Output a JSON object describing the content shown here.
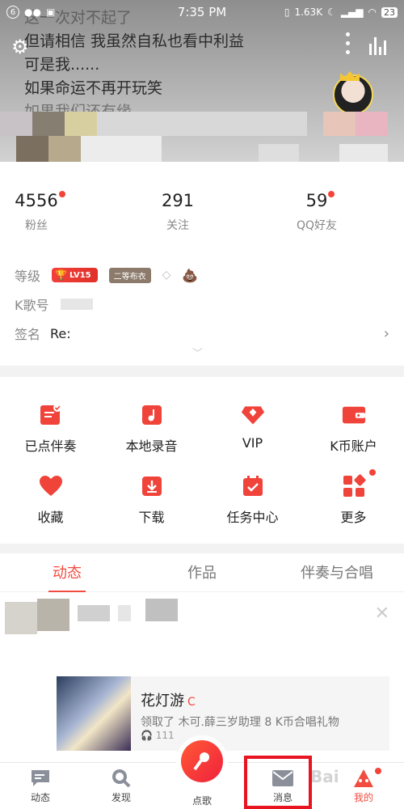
{
  "status_bar": {
    "notif_count": "6",
    "time": "7:35 PM",
    "speed": "1.63K",
    "battery": "23"
  },
  "lyrics": [
    "这一次对不起了",
    "但请相信 我虽然自私也看中利益",
    "可是我......",
    "如果命运不再开玩笑",
    "如果我们还有缘"
  ],
  "stats": [
    {
      "value": "4556",
      "label": "粉丝",
      "has_dot": true
    },
    {
      "value": "291",
      "label": "关注",
      "has_dot": false
    },
    {
      "value": "59",
      "label": "QQ好友",
      "has_dot": true
    }
  ],
  "profile": {
    "level_label": "等级",
    "level_badge": "LV15",
    "cloth_badge": "二等布衣",
    "kid_label": "K歌号",
    "signature_label": "签名",
    "signature_value": "Re:"
  },
  "menu": [
    {
      "label": "已点伴奏",
      "icon": "accompaniment-icon",
      "dot": false
    },
    {
      "label": "本地录音",
      "icon": "local-recording-icon",
      "dot": false
    },
    {
      "label": "VIP",
      "icon": "vip-diamond-icon",
      "dot": false
    },
    {
      "label": "K币账户",
      "icon": "wallet-icon",
      "dot": false
    },
    {
      "label": "收藏",
      "icon": "heart-icon",
      "dot": false
    },
    {
      "label": "下载",
      "icon": "download-icon",
      "dot": false
    },
    {
      "label": "任务中心",
      "icon": "task-calendar-icon",
      "dot": false
    },
    {
      "label": "更多",
      "icon": "more-grid-icon",
      "dot": true
    }
  ],
  "tabs": [
    {
      "label": "动态",
      "active": true
    },
    {
      "label": "作品",
      "active": false
    },
    {
      "label": "伴奏与合唱",
      "active": false
    }
  ],
  "feed": {
    "song_title": "花灯游",
    "song_badge": "C",
    "song_desc": "领取了 木可.薛三岁助理 8 K币合唱礼物",
    "song_plays": "111"
  },
  "bottom_nav": [
    {
      "label": "动态",
      "icon": "feed-icon"
    },
    {
      "label": "发现",
      "icon": "discover-icon"
    },
    {
      "label": "点歌",
      "icon": "sing-icon"
    },
    {
      "label": "消息",
      "icon": "message-icon"
    },
    {
      "label": "我的",
      "icon": "me-icon"
    }
  ],
  "colors": {
    "accent": "#f24b3f",
    "highlight_box": "#e8141f"
  }
}
